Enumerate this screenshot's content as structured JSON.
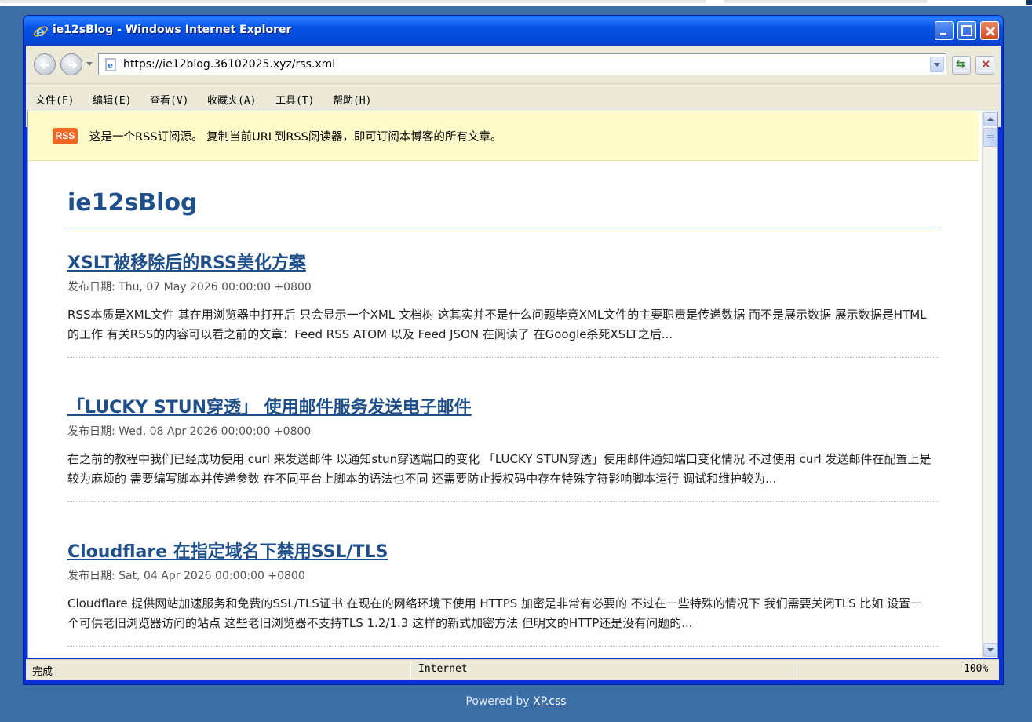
{
  "window": {
    "title": "ie12sBlog - Windows Internet Explorer"
  },
  "address_bar": {
    "url": "https://ie12blog.36102025.xyz/rss.xml"
  },
  "menu": {
    "items": [
      {
        "label": "文件(F)"
      },
      {
        "label": "编辑(E)"
      },
      {
        "label": "查看(V)"
      },
      {
        "label": "收藏夹(A)"
      },
      {
        "label": "工具(T)"
      },
      {
        "label": "帮助(H)"
      }
    ]
  },
  "rss_banner": {
    "badge": "RSS",
    "message": "这是一个RSS订阅源。 复制当前URL到RSS阅读器，即可订阅本博客的所有文章。"
  },
  "blog": {
    "title": "ie12sBlog",
    "posts": [
      {
        "title": "XSLT被移除后的RSS美化方案",
        "date": "发布日期: Thu, 07 May 2026 00:00:00 +0800",
        "excerpt": "RSS本质是XML文件 其在用浏览器中打开后 只会显示一个XML 文档树 这其实并不是什么问题毕竟XML文件的主要职责是传递数据 而不是展示数据 展示数据是HTML的工作 有关RSS的内容可以看之前的文章：Feed RSS ATOM 以及 Feed JSON 在阅读了 在Google杀死XSLT之后..."
      },
      {
        "title": "「LUCKY STUN穿透」 使用邮件服务发送电子邮件",
        "date": "发布日期: Wed, 08 Apr 2026 00:00:00 +0800",
        "excerpt": "在之前的教程中我们已经成功使用 curl 来发送邮件 以通知stun穿透端口的变化 「LUCKY STUN穿透」使用邮件通知端口变化情况 不过使用 curl 发送邮件在配置上是较为麻烦的 需要编写脚本并传递参数 在不同平台上脚本的语法也不同 还需要防止授权码中存在特殊字符影响脚本运行 调试和维护较为..."
      },
      {
        "title": "Cloudflare 在指定域名下禁用SSL/TLS",
        "date": "发布日期: Sat, 04 Apr 2026 00:00:00 +0800",
        "excerpt": "Cloudflare 提供网站加速服务和免费的SSL/TLS证书 在现在的网络环境下使用 HTTPS 加密是非常有必要的 不过在一些特殊的情况下 我们需要关闭TLS 比如 设置一个可供老旧浏览器访问的站点 这些老旧浏览器不支持TLS 1.2/1.3 这样的新式加密方法 但明文的HTTP还是没有问题的..."
      }
    ]
  },
  "status_bar": {
    "status": "完成",
    "zone": "Internet",
    "zoom": "100%"
  },
  "footer": {
    "prefix": "Powered by ",
    "link": "XP.css"
  },
  "icons": {
    "ie_logo": "ie-logo-icon",
    "page": "page-icon",
    "back": "back-arrow-icon",
    "forward": "forward-arrow-icon",
    "refresh": "refresh-icon",
    "stop": "stop-icon"
  },
  "colors": {
    "desktop": "#3a6ea5",
    "title_bar": "#0653e6",
    "link": "#1f4f8a",
    "rss_badge": "#f26722",
    "banner": "#fffcc9"
  }
}
